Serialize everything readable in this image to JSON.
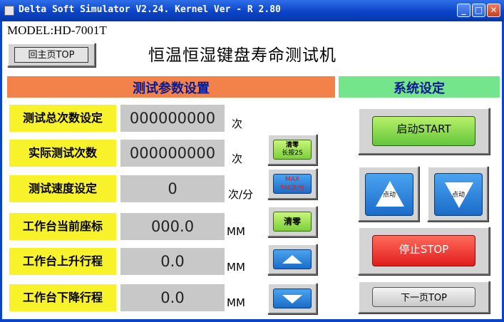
{
  "window": {
    "title": "Delta Soft Simulator V2.24. Kernel Ver - R 2.80",
    "min_icon": "minimize-icon",
    "max_icon": "maximize-icon",
    "close_icon": "close-icon",
    "close_glyph": "✕"
  },
  "header": {
    "model": "MODEL:HD-7001T",
    "home_button": "回主页TOP",
    "title": "恒温恒湿键盘寿命测试机"
  },
  "sections": {
    "left_title": "测试参数设置",
    "right_title": "系统设定"
  },
  "params": [
    {
      "label": "测试总次数设定",
      "value": "000000000",
      "unit": "次"
    },
    {
      "label": "实际测试次数",
      "value": "000000000",
      "unit": "次"
    },
    {
      "label": "测试速度设定",
      "value": "0",
      "unit": "次/分"
    },
    {
      "label": "工作台当前座标",
      "value": "000.0",
      "unit": "MM"
    },
    {
      "label": "工作台上升行程",
      "value": "0.0",
      "unit": "MM"
    },
    {
      "label": "工作台下降行程",
      "value": "0.0",
      "unit": "MM"
    }
  ],
  "side_buttons": {
    "clear_hold_line1": "清零",
    "clear_hold_line2": "长按2S",
    "max_line1": "MAX",
    "max_line2": "500次/分",
    "clear": "清零",
    "up_icon": "arrow-up-icon",
    "down_icon": "arrow-down-icon"
  },
  "system": {
    "start": "启动START",
    "jog_up": "点动",
    "jog_down": "点动",
    "stop": "停止STOP",
    "next_page": "下一页TOP"
  },
  "colors": {
    "titlebar": "#0a44c8",
    "label_bg": "#f7f22a",
    "value_bg": "#c8c8c8",
    "left_header": "#f2814a",
    "right_header": "#74e58a",
    "start": "#62c63c",
    "stop": "#e11d1d",
    "blue_button": "#1b6cc8"
  }
}
